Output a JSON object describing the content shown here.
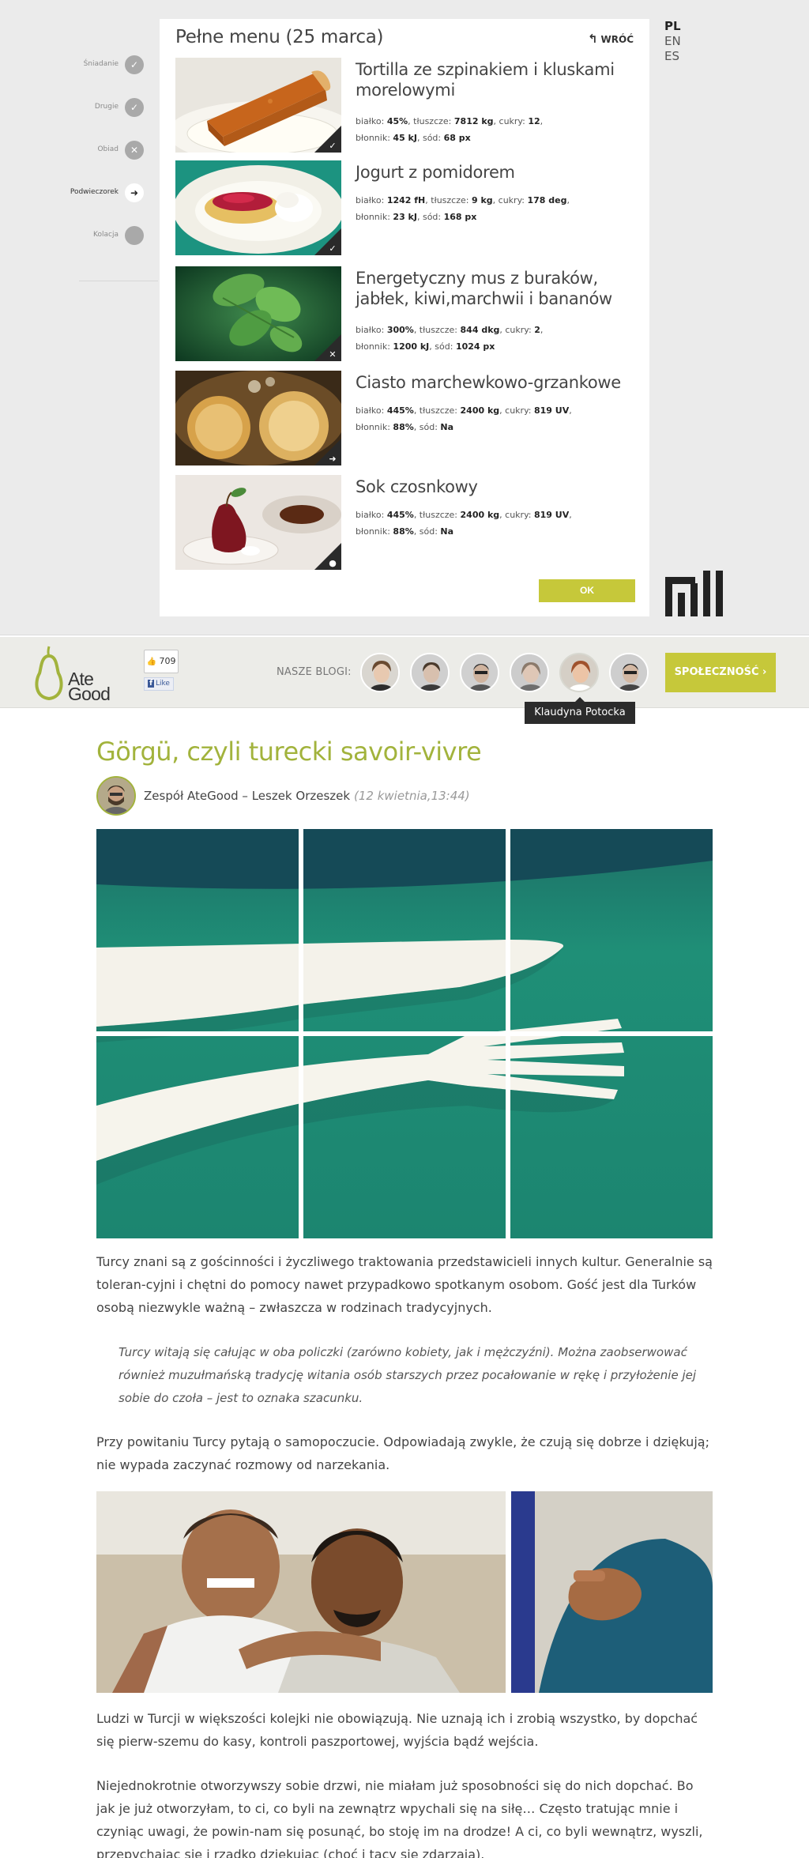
{
  "menu": {
    "title": "Pełne menu (25 marca)",
    "back_label": "WRÓĆ",
    "ok_label": "OK",
    "meals": [
      {
        "label": "Śniadanie",
        "status": "done"
      },
      {
        "label": "Drugie",
        "status": "done"
      },
      {
        "label": "Obiad",
        "status": "skipped"
      },
      {
        "label": "Podwieczorek",
        "status": "current"
      },
      {
        "label": "Kolacja",
        "status": "pending"
      }
    ],
    "dishes": [
      {
        "name": "Tortilla ze szpinakiem i kluskami morelowymi",
        "l1_a": "białko:",
        "l1_av": "45%",
        "l1_b": ", tłuszcze:",
        "l1_bv": "7812 kg",
        "l1_c": ", cukry:",
        "l1_cv": "12",
        "l1_end": ",",
        "l2_a": "błonnik:",
        "l2_av": "45 kJ",
        "l2_b": ", sód:",
        "l2_bv": "68 px",
        "status": "check"
      },
      {
        "name": "Jogurt z pomidorem",
        "l1_a": "białko:",
        "l1_av": "1242 fH",
        "l1_b": ", tłuszcze:",
        "l1_bv": "9 kg",
        "l1_c": ", cukry:",
        "l1_cv": "178 deg",
        "l1_end": ",",
        "l2_a": "błonnik:",
        "l2_av": "23 kJ",
        "l2_b": ", sód:",
        "l2_bv": "168 px",
        "status": "check"
      },
      {
        "name": "Energetyczny mus z buraków, jabłek, kiwi,marchwii i bananów",
        "l1_a": "białko:",
        "l1_av": "300%",
        "l1_b": ", tłuszcze:",
        "l1_bv": "844 dkg",
        "l1_c": ", cukry:",
        "l1_cv": "2",
        "l1_end": ",",
        "l2_a": "błonnik:",
        "l2_av": "1200 kJ",
        "l2_b": ", sód:",
        "l2_bv": "1024 px",
        "status": "cross"
      },
      {
        "name": "Ciasto marchewkowo-grzankowe",
        "l1_a": "białko:",
        "l1_av": "445%",
        "l1_b": ", tłuszcze:",
        "l1_bv": "2400 kg",
        "l1_c": ", cukry:",
        "l1_cv": "819 UV",
        "l1_end": ",",
        "l2_a": "błonnik:",
        "l2_av": "88%",
        "l2_b": ", sód:",
        "l2_bv": "Na",
        "status": "arrow"
      },
      {
        "name": "Sok czosnkowy",
        "l1_a": "białko:",
        "l1_av": "445%",
        "l1_b": ", tłuszcze:",
        "l1_bv": "2400 kg",
        "l1_c": ", cukry:",
        "l1_cv": "819 UV",
        "l1_end": ",",
        "l2_a": "błonnik:",
        "l2_av": "88%",
        "l2_b": ", sód:",
        "l2_bv": "Na",
        "status": "dot"
      }
    ]
  },
  "languages": [
    "PL",
    "EN",
    "ES"
  ],
  "header": {
    "logo_line1": "Ate",
    "logo_line2": "Good",
    "fb_count": "709",
    "fb_like": "Like",
    "fb_f": "f",
    "blogs_label": "NASZE BLOGI:",
    "community_label": "SPOŁECZNOŚĆ ›",
    "tooltip": "Klaudyna Potocka"
  },
  "article": {
    "title": "Görgü, czyli turecki savoir-vivre",
    "author": "Zespół AteGood – Leszek Orzeszek",
    "date": "(12 kwietnia,13:44)",
    "p1": "Turcy znani są z gościnności i życzliwego traktowania przedstawicieli innych kultur. Generalnie są toleran-cyjni i chętni do pomocy nawet przypadkowo spotkanym osobom. Gość jest dla Turków osobą niezwykle ważną – zwłaszcza w rodzinach tradycyjnych.",
    "quote": "Turcy witają się całując w oba policzki (zarówno kobiety, jak i mężczyźni). Można zaobserwować również muzułmańską tradycję witania osób starszych przez pocałowanie w rękę i przyłożenie jej sobie do czoła – jest to oznaka szacunku.",
    "p2": "Przy powitaniu Turcy pytają o samopoczucie. Odpowiadają zwykle, że czują się dobrze i dziękują; nie wypada zaczynać rozmowy od narzekania.",
    "p3": "Ludzi w Turcji w większości kolejki nie obowiązują. Nie uznają ich i zrobią wszystko, by dopchać się pierw-szemu do kasy, kontroli paszportowej, wyjścia bądź wejścia.",
    "p4": "Niejednokrotnie otworzywszy sobie drzwi, nie miałam już sposobności się do nich dopchać. Bo jak je już otworzyłam, to ci, co byli na zewnątrz wpychali się na siłę… Często tratując mnie i czyniąc uwagi, że powin-nam się posunąć, bo stoję im na drodze! A ci, co byli wewnątrz, wyszli, przepychając się i rzadko dziękując (choć i tacy się zdarzają)."
  },
  "colors": {
    "accent": "#c6c83a",
    "title_green": "#a2b33c",
    "teal": "#1f8f77",
    "dark": "#2a2a2a"
  }
}
